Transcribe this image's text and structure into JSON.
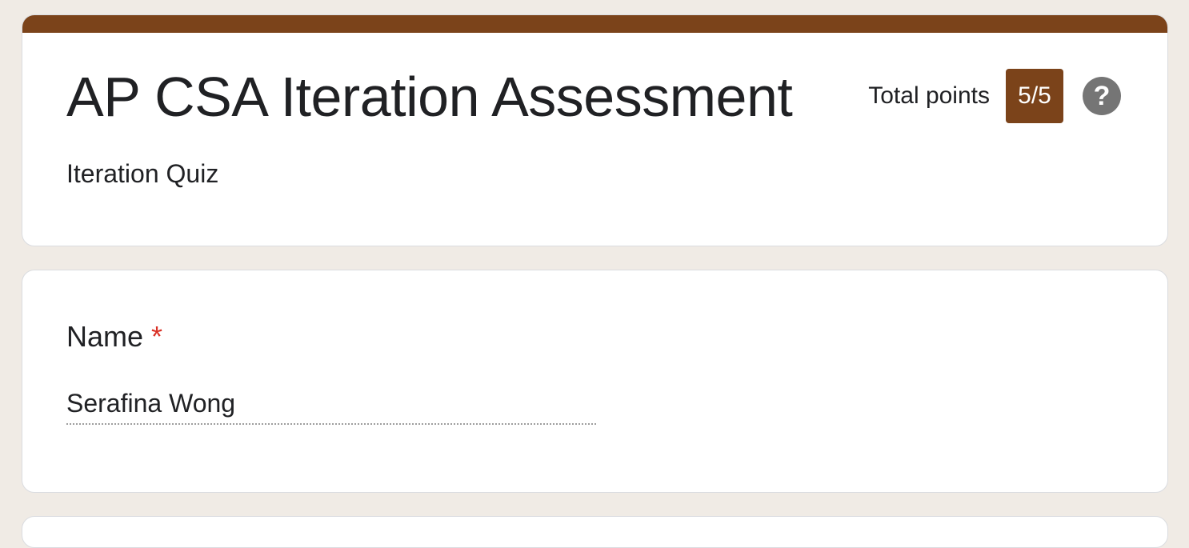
{
  "header": {
    "title": "AP CSA Iteration Assessment",
    "total_points_label": "Total points",
    "score": "5/5",
    "help_symbol": "?",
    "description": "Iteration Quiz"
  },
  "question": {
    "label": "Name",
    "required_mark": "*",
    "answer": "Serafina Wong"
  },
  "colors": {
    "accent": "#7b431a",
    "background": "#f0ebe5",
    "required": "#d93025"
  },
  "icons": {
    "help": "help-icon"
  }
}
